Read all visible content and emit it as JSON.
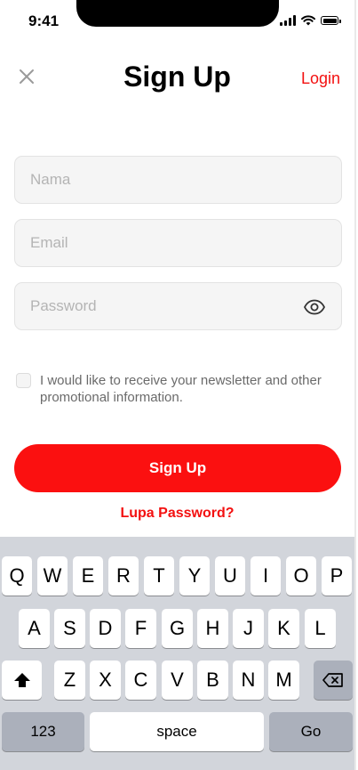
{
  "status_bar": {
    "time": "9:41"
  },
  "header": {
    "title": "Sign Up",
    "login_label": "Login"
  },
  "form": {
    "name_placeholder": "Nama",
    "email_placeholder": "Email",
    "password_placeholder": "Password",
    "newsletter_label": "I would like to receive your newsletter and other promotional information.",
    "newsletter_checked": false,
    "submit_label": "Sign Up",
    "forgot_label": "Lupa Password?"
  },
  "keyboard": {
    "row1": [
      "Q",
      "W",
      "E",
      "R",
      "T",
      "Y",
      "U",
      "I",
      "O",
      "P"
    ],
    "row2": [
      "A",
      "S",
      "D",
      "F",
      "G",
      "H",
      "J",
      "K",
      "L"
    ],
    "row3": [
      "Z",
      "X",
      "C",
      "V",
      "B",
      "N",
      "M"
    ],
    "numbers_label": "123",
    "space_label": "space",
    "go_label": "Go",
    "shift_icon": "shift-icon",
    "backspace_icon": "backspace-icon"
  },
  "colors": {
    "accent": "#fb1010",
    "field_bg": "#f5f5f5",
    "keyboard_bg": "#d2d5db"
  }
}
